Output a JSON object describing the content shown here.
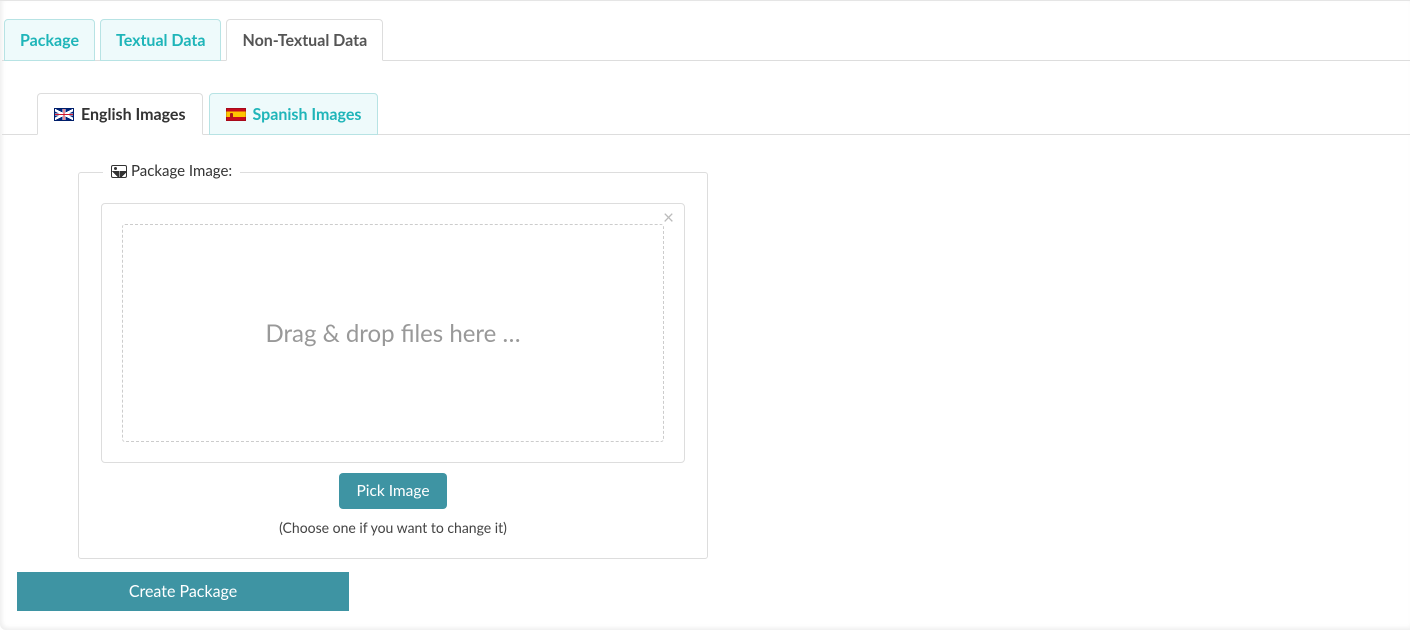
{
  "tabs": {
    "package": "Package",
    "textual": "Textual Data",
    "nontextual": "Non-Textual Data"
  },
  "lang_tabs": {
    "english": "English Images",
    "spanish": "Spanish Images"
  },
  "panel": {
    "legend": "Package Image:",
    "drop_text": "Drag & drop files here …",
    "pick_button": "Pick Image",
    "hint": "(Choose one if you want to change it)"
  },
  "create_button": "Create Package"
}
